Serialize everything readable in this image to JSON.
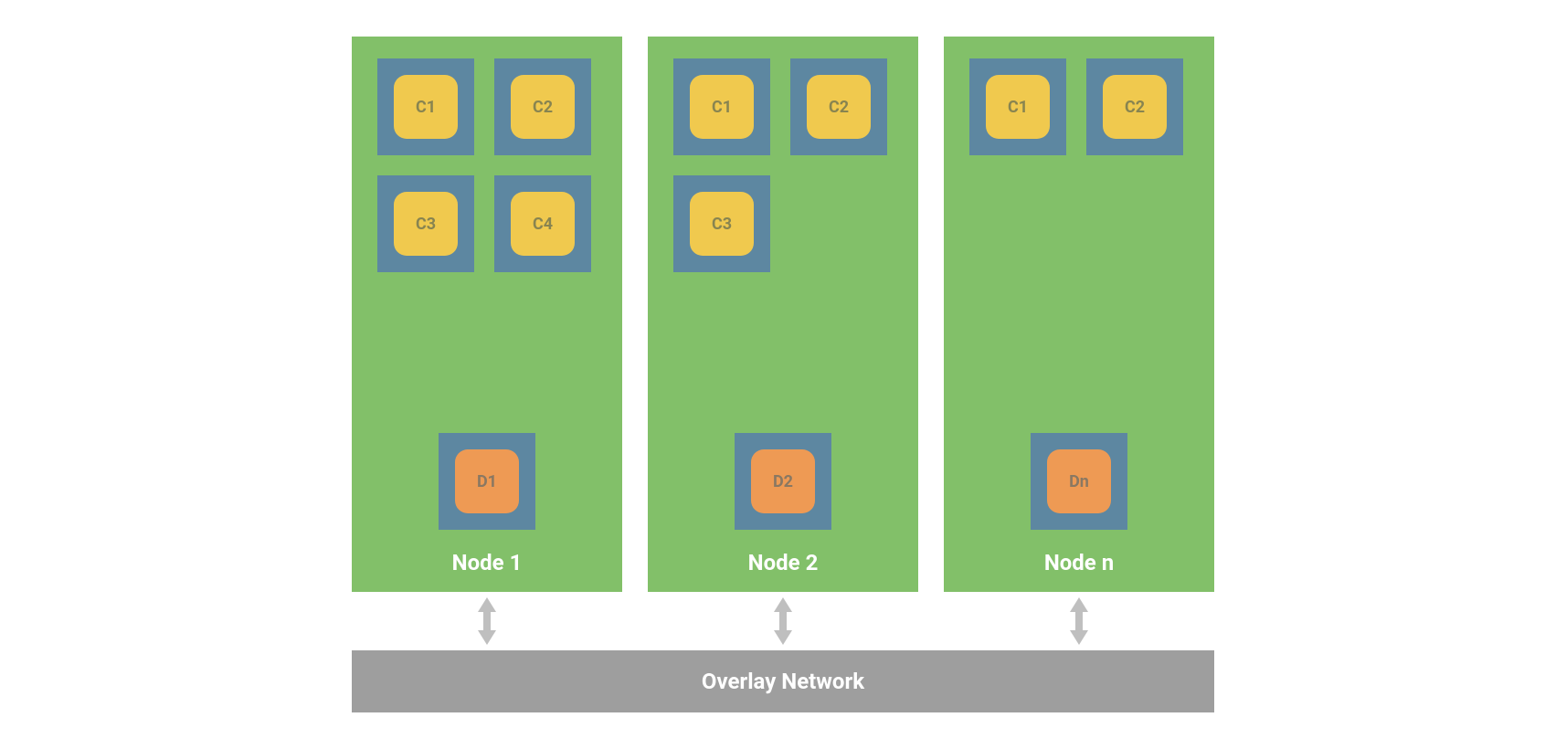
{
  "nodes": [
    {
      "label": "Node 1",
      "containers": [
        "C1",
        "C2",
        "C3",
        "C4"
      ],
      "daemon": "D1"
    },
    {
      "label": "Node 2",
      "containers": [
        "C1",
        "C2",
        "C3"
      ],
      "daemon": "D2"
    },
    {
      "label": "Node n",
      "containers": [
        "C1",
        "C2"
      ],
      "daemon": "Dn"
    }
  ],
  "network_label": "Overlay Network",
  "colors": {
    "node_bg": "#82c069",
    "container_outer": "#5d87a1",
    "container_yellow": "#f0c94e",
    "container_orange": "#ee9a54",
    "network_bar": "#9e9e9e",
    "arrow": "#bfbfbf"
  }
}
